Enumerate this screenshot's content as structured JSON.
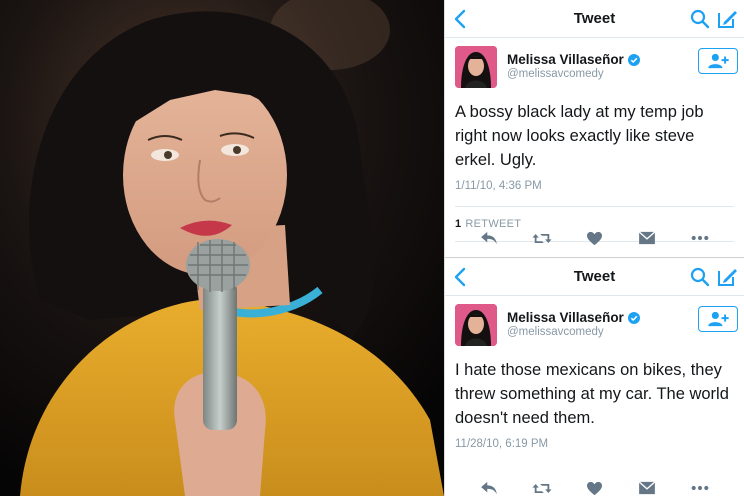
{
  "tweets": [
    {
      "nav_title": "Tweet",
      "author_name": "Melissa Villaseñor",
      "author_handle": "@melissavcomedy",
      "text": "A bossy black lady at my temp job right now looks exactly like steve erkel. Ugly.",
      "timestamp": "1/11/10, 4:36 PM",
      "retweet_count": "1",
      "retweet_label": "RETWEET"
    },
    {
      "nav_title": "Tweet",
      "author_name": "Melissa Villaseñor",
      "author_handle": "@melissavcomedy",
      "text": "I hate those mexicans on bikes, they threw something at my car. The world doesn't need them.",
      "timestamp": "11/28/10, 6:19 PM"
    }
  ],
  "icons": [
    "back-chevron-icon",
    "search-icon",
    "compose-icon",
    "verified-badge-icon",
    "follow-user-icon",
    "reply-icon",
    "retweet-icon",
    "like-heart-icon",
    "direct-message-icon",
    "more-options-icon"
  ],
  "colors": {
    "accent": "#1da1f2",
    "text": "#14171a",
    "muted": "#8899a6",
    "sweater": "#e2a325",
    "hair": "#141010"
  }
}
